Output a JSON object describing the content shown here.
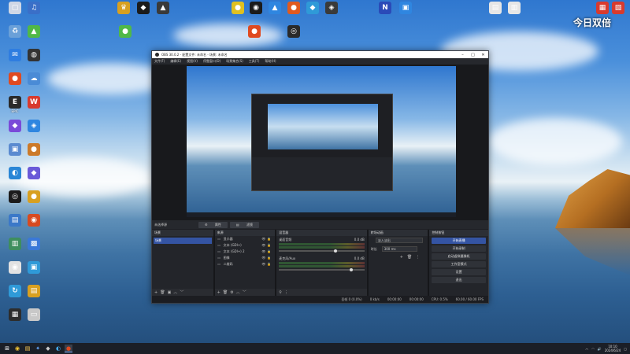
{
  "desktop": {
    "overlay_text": "今日双倍",
    "icons_left": [
      {
        "label": "",
        "glyph": "▢",
        "color": "#cfd7e6"
      },
      {
        "label": "",
        "glyph": "♻",
        "color": "#6aa0d8"
      },
      {
        "label": "",
        "glyph": "✉",
        "color": "#2f7de0"
      },
      {
        "label": "",
        "glyph": "●",
        "color": "#e04a20"
      },
      {
        "label": "EPIC",
        "glyph": "E",
        "color": "#2a2a2a"
      },
      {
        "label": "",
        "glyph": "◆",
        "color": "#7a4ad8"
      },
      {
        "label": "",
        "glyph": "▣",
        "color": "#5a8ad0"
      },
      {
        "label": "",
        "glyph": "◐",
        "color": "#2a86d6"
      },
      {
        "label": "",
        "glyph": "◎",
        "color": "#1b1b1b"
      },
      {
        "label": "",
        "glyph": "▤",
        "color": "#3b78c8"
      },
      {
        "label": "",
        "glyph": "▥",
        "color": "#3e8e5e"
      },
      {
        "label": "",
        "glyph": "◉",
        "color": "#e2e2e2"
      },
      {
        "label": "",
        "glyph": "↻",
        "color": "#2f9ad8"
      },
      {
        "label": "",
        "glyph": "▦",
        "color": "#2d2d2d"
      },
      {
        "label": "",
        "glyph": "♫",
        "color": "#3a6fc8"
      },
      {
        "label": "",
        "glyph": "▲",
        "color": "#50b848"
      },
      {
        "label": "",
        "glyph": "◍",
        "color": "#333333"
      },
      {
        "label": "",
        "glyph": "☁",
        "color": "#4a8bd6"
      },
      {
        "label": "",
        "glyph": "W",
        "color": "#d83a2e"
      },
      {
        "label": "",
        "glyph": "◈",
        "color": "#2f86e0"
      },
      {
        "label": "",
        "glyph": "●",
        "color": "#cc7a2a"
      },
      {
        "label": "",
        "glyph": "◆",
        "color": "#6a5ad8"
      },
      {
        "label": "",
        "glyph": "●",
        "color": "#d8a020"
      },
      {
        "label": "",
        "glyph": "◉",
        "color": "#d84a20"
      },
      {
        "label": "",
        "glyph": "▩",
        "color": "#3a78d8"
      },
      {
        "label": "",
        "glyph": "▣",
        "color": "#2f9ad8"
      },
      {
        "label": "",
        "glyph": "▤",
        "color": "#d8a020"
      },
      {
        "label": "",
        "glyph": "▭",
        "color": "#c8c8c8"
      }
    ],
    "icons_top": [
      {
        "label": "",
        "glyph": "♛",
        "color": "#d8a020"
      },
      {
        "label": "",
        "glyph": "◆",
        "color": "#1b1b1b"
      },
      {
        "label": "",
        "glyph": "▲",
        "color": "#3a3a3a"
      },
      {
        "label": "",
        "glyph": "●",
        "color": "#e0c020"
      },
      {
        "label": "",
        "glyph": "◉",
        "color": "#1b1b1b"
      },
      {
        "label": "",
        "glyph": "▲",
        "color": "#2f86e0"
      },
      {
        "label": "",
        "glyph": "●",
        "color": "#e05a20"
      },
      {
        "label": "",
        "glyph": "◆",
        "color": "#2f9ad8"
      },
      {
        "label": "",
        "glyph": "◈",
        "color": "#3a3a3a"
      },
      {
        "label": "",
        "glyph": "●",
        "color": "#50b848"
      },
      {
        "label": "",
        "glyph": "●",
        "color": "#e04a20"
      },
      {
        "label": "",
        "glyph": "◎",
        "color": "#2a2a2a"
      },
      {
        "label": "",
        "glyph": "N",
        "color": "#2a4ab8"
      },
      {
        "label": "",
        "glyph": "▣",
        "color": "#2f86e0"
      },
      {
        "label": "",
        "glyph": "▤",
        "color": "#e6e6e6"
      },
      {
        "label": "",
        "glyph": "▥",
        "color": "#e6e6e6"
      },
      {
        "label": "",
        "glyph": "▦",
        "color": "#d83a2e"
      },
      {
        "label": "",
        "glyph": "▧",
        "color": "#d83a2e"
      }
    ]
  },
  "obs": {
    "title": "OBS 30.0.2 - 配置文件: 未命名 - 场景: 未命名",
    "menu": [
      "文件(F)",
      "编辑(E)",
      "视图(V)",
      "停靠窗口(D)",
      "场景集合(S)",
      "工具(T)",
      "帮助(H)"
    ],
    "status_line": {
      "label": "未选择源",
      "btn_properties": "属性",
      "btn_filters": "滤镜"
    },
    "docks": {
      "scenes": {
        "header": "场景",
        "items": [
          "场景"
        ]
      },
      "sources": {
        "header": "来源",
        "items": [
          {
            "icon": "▭",
            "label": "显示器"
          },
          {
            "icon": "▭",
            "label": "文本 (GDI+)"
          },
          {
            "icon": "▭",
            "label": "文本 (GDI+) 2"
          },
          {
            "icon": "▭",
            "label": "图像"
          },
          {
            "icon": "▭",
            "label": "二维码"
          }
        ]
      },
      "mixer": {
        "header": "混音器",
        "channels": [
          {
            "name": "桌面音频",
            "db": "0.0 dB"
          },
          {
            "name": "麦克风/Aux",
            "db": "0.0 dB"
          }
        ]
      },
      "transitions": {
        "header": "转场动画",
        "type_label": "",
        "type_value": "淡入淡出",
        "duration_label": "时长",
        "duration_value": "300 ms"
      },
      "controls": {
        "header": "控制按钮",
        "buttons": [
          "开始直播",
          "开始录制",
          "启动虚拟摄像机",
          "工作室模式",
          "设置",
          "退出"
        ]
      }
    },
    "statusbar": {
      "frames": "丢帧 0 (0.0%)",
      "kbps": "0 kb/s",
      "rec": "00:00:00",
      "live": "00:00:00",
      "cpu": "CPU: 0.5%",
      "fps": "60.00 / 60.00 FPS"
    }
  },
  "taskbar": {
    "apps": [
      {
        "glyph": "⊞",
        "color": "#ffffff"
      },
      {
        "glyph": "◉",
        "color": "#ffcc33"
      },
      {
        "glyph": "▤",
        "color": "#ffcc55"
      },
      {
        "glyph": "✦",
        "color": "#66aaff"
      },
      {
        "glyph": "◆",
        "color": "#cccccc"
      },
      {
        "glyph": "◐",
        "color": "#44aaee"
      },
      {
        "glyph": "●",
        "color": "#e04a20"
      }
    ],
    "time": "10:10",
    "date": "2024/6/24"
  }
}
